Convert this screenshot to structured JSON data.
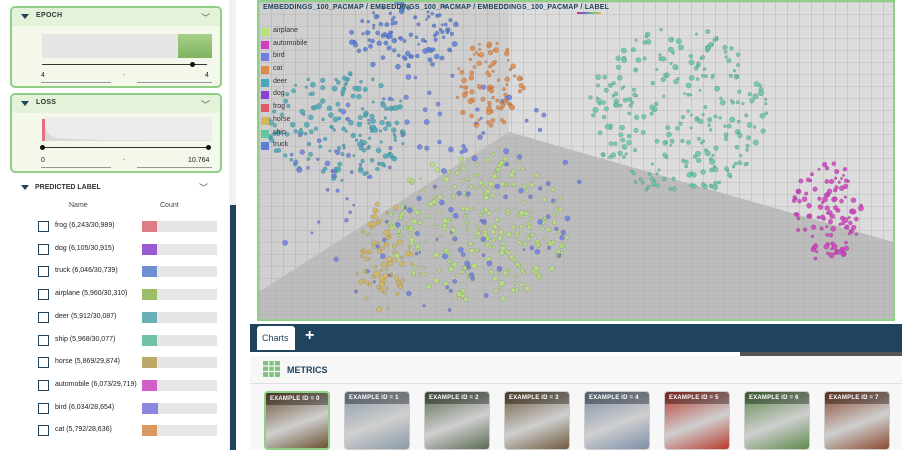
{
  "epoch_panel": {
    "title": "EPOCH",
    "min_value": "4",
    "max_value": "4",
    "dash": "-"
  },
  "loss_panel": {
    "title": "LOSS",
    "min_value": "0",
    "max_value": "10.764",
    "dash": "-"
  },
  "predicted_label": {
    "title": "PREDICTED LABEL",
    "col_name": "Name",
    "col_count": "Count",
    "rows": [
      {
        "label": "frog (6,243/30,989)",
        "fraction": 0.201,
        "color": "#e07a86"
      },
      {
        "label": "dog (6,105/30,915)",
        "fraction": 0.197,
        "color": "#9b59d6"
      },
      {
        "label": "truck (6,046/30,739)",
        "fraction": 0.197,
        "color": "#6d8fd4"
      },
      {
        "label": "airplane (5,960/30,310)",
        "fraction": 0.197,
        "color": "#9cbd6a"
      },
      {
        "label": "deer (5,912/30,087)",
        "fraction": 0.196,
        "color": "#69b0b8"
      },
      {
        "label": "ship (5,968/30,077)",
        "fraction": 0.198,
        "color": "#6fc2a6"
      },
      {
        "label": "horse (5,869/29,874)",
        "fraction": 0.196,
        "color": "#bba86a"
      },
      {
        "label": "automobile (6,073/29,719)",
        "fraction": 0.204,
        "color": "#d060c8"
      },
      {
        "label": "bird (6,034/28,654)",
        "fraction": 0.211,
        "color": "#8b86e0"
      },
      {
        "label": "cat (5,792/28,636)",
        "fraction": 0.202,
        "color": "#d89a5e"
      }
    ]
  },
  "view": {
    "breadcrumb": "EMBEDDINGS_100_PACMAP / EMBEDDINGS_100_PACMAP / EMBEDDINGS_100_PACMAP / LABEL",
    "legend": [
      {
        "label": "airplane",
        "color": "#b7e07e"
      },
      {
        "label": "automobile",
        "color": "#d13fc0"
      },
      {
        "label": "bird",
        "color": "#6f7fe0"
      },
      {
        "label": "cat",
        "color": "#e08a48"
      },
      {
        "label": "deer",
        "color": "#49a9b8"
      },
      {
        "label": "dog",
        "color": "#8a3fd8"
      },
      {
        "label": "frog",
        "color": "#e05a6a"
      },
      {
        "label": "horse",
        "color": "#d6b85a"
      },
      {
        "label": "ship",
        "color": "#62c7a0"
      },
      {
        "label": "truck",
        "color": "#5b7fd6"
      }
    ]
  },
  "tabs": {
    "charts_label": "Charts",
    "add_label": "+"
  },
  "metrics": {
    "title": "METRICS"
  },
  "examples": [
    {
      "label": "EXAMPLE ID = 0",
      "color": "#6b5233"
    },
    {
      "label": "EXAMPLE ID = 1",
      "color": "#8a9aa8"
    },
    {
      "label": "EXAMPLE ID = 2",
      "color": "#5a6b52"
    },
    {
      "label": "EXAMPLE ID = 3",
      "color": "#6e5a3c"
    },
    {
      "label": "EXAMPLE ID = 4",
      "color": "#7c8fa8"
    },
    {
      "label": "EXAMPLE ID = 5",
      "color": "#b83a2e"
    },
    {
      "label": "EXAMPLE ID = 6",
      "color": "#5d8a4a"
    },
    {
      "label": "EXAMPLE ID = 7",
      "color": "#8a4a2e"
    }
  ]
}
